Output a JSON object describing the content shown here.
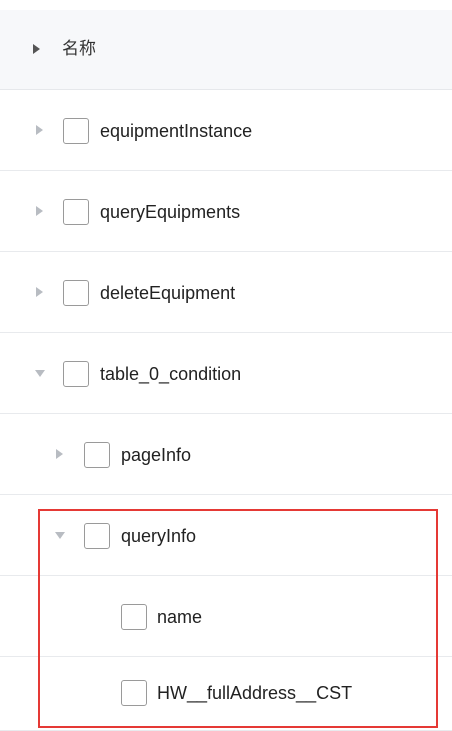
{
  "header": {
    "label": "名称"
  },
  "rows": [
    {
      "label": "equipmentInstance",
      "expanded": false,
      "checked": false
    },
    {
      "label": "queryEquipments",
      "expanded": false,
      "checked": false
    },
    {
      "label": "deleteEquipment",
      "expanded": false,
      "checked": false
    },
    {
      "label": "table_0_condition",
      "expanded": true,
      "checked": false
    },
    {
      "label": "pageInfo",
      "expanded": false,
      "checked": false
    },
    {
      "label": "queryInfo",
      "expanded": true,
      "checked": false
    },
    {
      "label": "name",
      "checked": false
    },
    {
      "label": "HW__fullAddress__CST",
      "checked": false
    }
  ],
  "colors": {
    "highlight": "#e53935",
    "header_bg": "#f7f8fa",
    "caret": "#b8bcc2",
    "checkbox_border": "#9a9a9a"
  }
}
